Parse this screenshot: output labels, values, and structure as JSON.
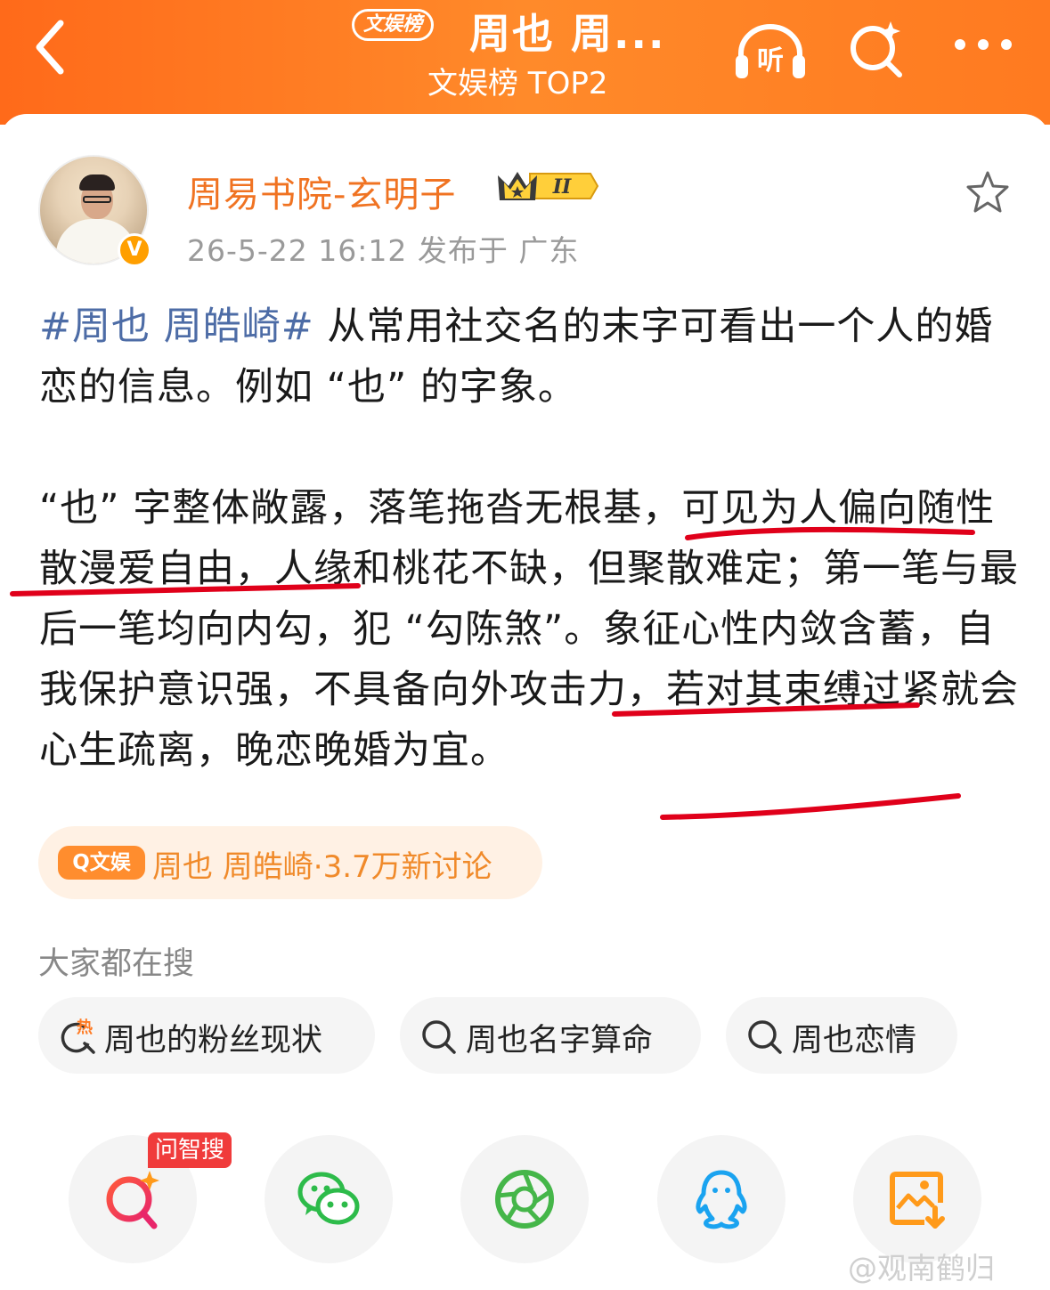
{
  "header": {
    "brand_pill": "文娱榜",
    "title": "周也 周...",
    "subtitle": "文娱榜 TOP2",
    "listen_label": "听"
  },
  "author": {
    "name": "周易书院-玄明子",
    "badge": "V",
    "level": "II",
    "meta": "26-5-22 16:12  发布于 广东"
  },
  "post": {
    "hashtag": "#周也 周皓崎#",
    "line1_rest": " 从常用社交名的末字可看出一个人的婚恋的信息。例如 “也” 的字象。",
    "para2": "“也” 字整体敞露，落笔拖沓无根基，可见为人偏向随性散漫爱自由，人缘和桃花不缺，但聚散难定；第一笔与最后一笔均向内勾，犯 “勾陈煞”。象征心性内敛含蓄，自我保护意识强，不具备向外攻击力，若对其束缚过紧就会心生疏离，晚恋晚婚为宜。"
  },
  "topic": {
    "tag": "Q文娱",
    "text": "周也 周皓崎·3.7万新讨论"
  },
  "searches": {
    "title": "大家都在搜",
    "items": [
      {
        "label": "周也的粉丝现状",
        "hot_label": "热"
      },
      {
        "label": "周也名字算命"
      },
      {
        "label": "周也恋情"
      }
    ]
  },
  "share": {
    "ai_label": "问智搜"
  },
  "watermark": "@观南鹤归",
  "colors": {
    "accent": "#ff7a22",
    "username": "#f07322",
    "hashtag": "#4d6ca6",
    "annotation": "#e0001a"
  }
}
